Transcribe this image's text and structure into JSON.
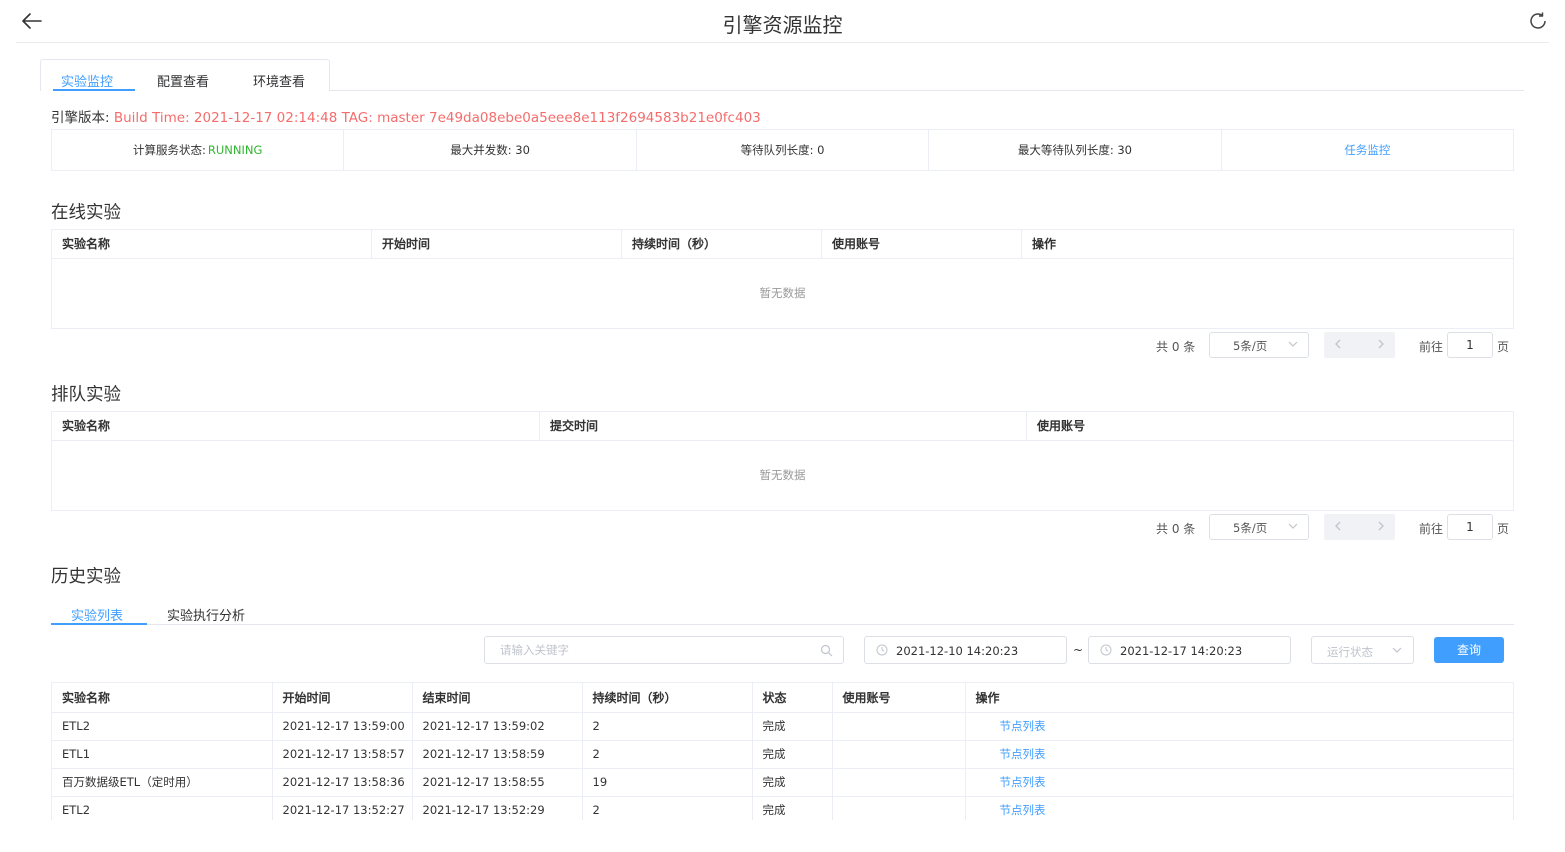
{
  "header": {
    "title": "引擎资源监控"
  },
  "main_tabs": [
    "实验监控",
    "配置查看",
    "环境查看"
  ],
  "engine": {
    "label": "引擎版本:",
    "value": "Build Time: 2021-12-17 02:14:48 TAG: master 7e49da08ebe0a5eee8e113f2694583b21e0fc403"
  },
  "stats": {
    "service_status_label": "计算服务状态:",
    "service_status_value": "RUNNING",
    "max_concurrency": "最大并发数: 30",
    "wait_queue_length": "等待队列长度: 0",
    "max_wait_queue_length": "最大等待队列长度: 30",
    "task_monitor_link": "任务监控"
  },
  "online": {
    "title": "在线实验",
    "columns": [
      "实验名称",
      "开始时间",
      "持续时间（秒）",
      "使用账号",
      "操作"
    ],
    "empty_text": "暂无数据",
    "pagination": {
      "total": "共 0 条",
      "page_size": "5条/页",
      "goto_label": "前往",
      "page": "1",
      "page_unit": "页"
    }
  },
  "queued": {
    "title": "排队实验",
    "columns": [
      "实验名称",
      "提交时间",
      "使用账号"
    ],
    "empty_text": "暂无数据",
    "pagination": {
      "total": "共 0 条",
      "page_size": "5条/页",
      "goto_label": "前往",
      "page": "1",
      "page_unit": "页"
    }
  },
  "history": {
    "title": "历史实验",
    "tabs": [
      "实验列表",
      "实验执行分析"
    ],
    "filters": {
      "search_placeholder": "请输入关键字",
      "start_date": "2021-12-10 14:20:23",
      "range_separator": "~",
      "end_date": "2021-12-17 14:20:23",
      "status_placeholder": "运行状态",
      "query_button": "查询"
    },
    "columns": [
      "实验名称",
      "开始时间",
      "结束时间",
      "持续时间（秒）",
      "状态",
      "使用账号",
      "操作"
    ],
    "rows": [
      {
        "name": "ETL2",
        "start": "2021-12-17 13:59:00",
        "end": "2021-12-17 13:59:02",
        "duration": "2",
        "status": "完成",
        "account": "",
        "action": "节点列表"
      },
      {
        "name": "ETL1",
        "start": "2021-12-17 13:58:57",
        "end": "2021-12-17 13:58:59",
        "duration": "2",
        "status": "完成",
        "account": "",
        "action": "节点列表"
      },
      {
        "name": "百万数据级ETL（定时用）",
        "start": "2021-12-17 13:58:36",
        "end": "2021-12-17 13:58:55",
        "duration": "19",
        "status": "完成",
        "account": "",
        "action": "节点列表"
      },
      {
        "name": "ETL2",
        "start": "2021-12-17 13:52:27",
        "end": "2021-12-17 13:52:29",
        "duration": "2",
        "status": "完成",
        "account": "",
        "action": "节点列表"
      }
    ]
  }
}
